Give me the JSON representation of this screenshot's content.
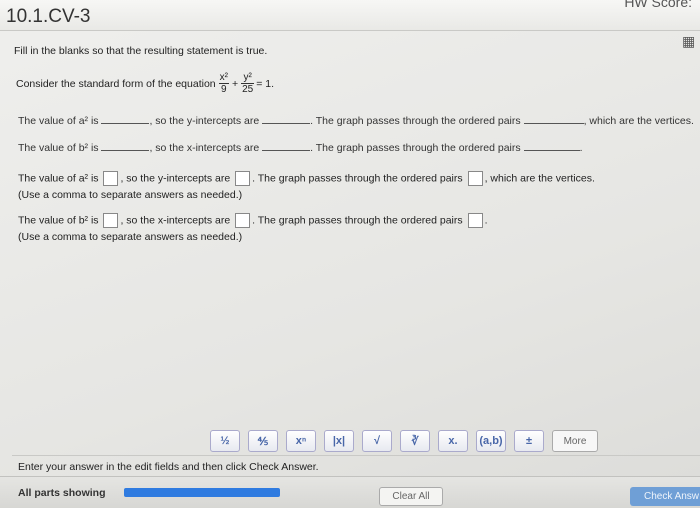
{
  "header": {
    "title": "10.1.CV-3",
    "score": "HW Score:"
  },
  "question": {
    "instruction": "Fill in the blanks so that the resulting statement is true.",
    "consider_prefix": "Consider the standard form of the equation",
    "eq": {
      "x_num": "x²",
      "x_den": "9",
      "plus": "+",
      "y_num": "y²",
      "y_den": "25",
      "rhs": "= 1."
    }
  },
  "faded": {
    "row1": {
      "a": "The value of a² is",
      "b": ", so the y-intercepts are",
      "c": ". The graph passes through the ordered pairs",
      "d": ", which are the vertices."
    },
    "row2": {
      "a": "The value of b² is",
      "b": ", so the x-intercepts are",
      "c": ". The graph passes through the ordered pairs",
      "d": "."
    }
  },
  "answer": {
    "row1_a": "The value of a² is",
    "row1_b": ", so the y-intercepts are",
    "row1_c": ". The graph passes through the ordered pairs",
    "row1_d": ", which are the vertices.",
    "row1_note": "(Use a comma to separate answers as needed.)",
    "row2_a": "The value of b² is",
    "row2_b": ", so the x-intercepts are",
    "row2_c": ". The graph passes through the ordered pairs",
    "row2_d": ".",
    "row2_note": "(Use a comma to separate answers as needed.)"
  },
  "toolbar": {
    "buttons": [
      "½",
      "⅘",
      "xⁿ",
      "|x|",
      "√",
      "∛",
      "x.",
      "(a,b)",
      "±"
    ],
    "more": "More"
  },
  "footer": {
    "hint": "Enter your answer in the edit fields and then click Check Answer.",
    "parts": "All parts showing",
    "clear": "Clear All",
    "check": "Check Answ"
  }
}
